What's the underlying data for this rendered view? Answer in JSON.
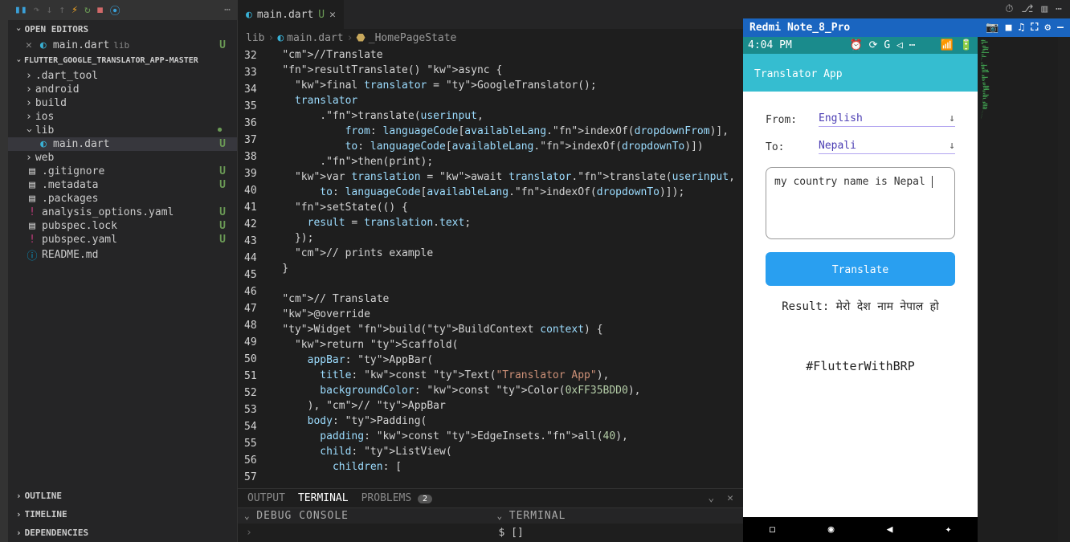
{
  "toolbar": {
    "continue": "▷",
    "pause": "▮▮"
  },
  "sidebar": {
    "openEditors": "OPEN EDITORS",
    "openFile": "main.dart",
    "openFileLang": "lib",
    "projectHeader": "FLUTTER_GOOGLE_TRANSLATOR_APP-MASTER",
    "folders": [
      ".dart_tool",
      "android",
      "build",
      "ios",
      "lib",
      "web"
    ],
    "libFile": "main.dart",
    "files": [
      {
        "name": ".gitignore",
        "badge": "U"
      },
      {
        "name": ".metadata",
        "badge": "U"
      },
      {
        "name": ".packages",
        "badge": ""
      },
      {
        "name": "analysis_options.yaml",
        "badge": "U",
        "icon": "yaml"
      },
      {
        "name": "pubspec.lock",
        "badge": "U"
      },
      {
        "name": "pubspec.yaml",
        "badge": "U",
        "icon": "yaml"
      },
      {
        "name": "README.md",
        "badge": "",
        "icon": "info"
      }
    ],
    "bottom": [
      "OUTLINE",
      "TIMELINE",
      "DEPENDENCIES"
    ]
  },
  "tab": {
    "file": "main.dart",
    "mod": "U"
  },
  "breadcrumb": {
    "p1": "lib",
    "p2": "main.dart",
    "p3": "_HomePageState"
  },
  "code": {
    "startLine": 32,
    "lines": [
      "//Translate",
      "resultTranslate() async {",
      "  final translator = GoogleTranslator();",
      "  translator",
      "      .translate(userinput,",
      "          from: languageCode[availableLang.indexOf(dropdownFrom)],",
      "          to: languageCode[availableLang.indexOf(dropdownTo)])",
      "      .then(print);",
      "  var translation = await translator.translate(userinput,",
      "      to: languageCode[availableLang.indexOf(dropdownTo)]);",
      "  setState(() {",
      "    result = translation.text;",
      "  });",
      "  // prints example",
      "}",
      "",
      "// Translate",
      "@override",
      "Widget build(BuildContext context) {",
      "  return Scaffold(",
      "    appBar: AppBar(",
      "      title: const Text(\"Translator App\"),",
      "      backgroundColor: const Color(0xFF35BDD0),",
      "    ), // AppBar",
      "    body: Padding(",
      "      padding: const EdgeInsets.all(40),",
      "      child: ListView(",
      "        children: ["
    ]
  },
  "panel": {
    "output": "OUTPUT",
    "terminal": "TERMINAL",
    "problems": "PROBLEMS",
    "problemsCount": "2",
    "debugConsole": "DEBUG CONSOLE",
    "terminalHead": "TERMINAL",
    "prompt": "$ []"
  },
  "preview": {
    "deviceName": "Redmi Note_8_Pro",
    "statusTime": "4:04 PM",
    "appTitle": "Translator App",
    "fromLabel": "From:",
    "fromValue": "English",
    "toLabel": "To:",
    "toValue": "Nepali",
    "inputText": "my country name is Nepal",
    "translateBtn": "Translate",
    "resultText": "Result: मेरो देश नाम नेपाल हो",
    "hashtag": "#FlutterWithBRP"
  }
}
